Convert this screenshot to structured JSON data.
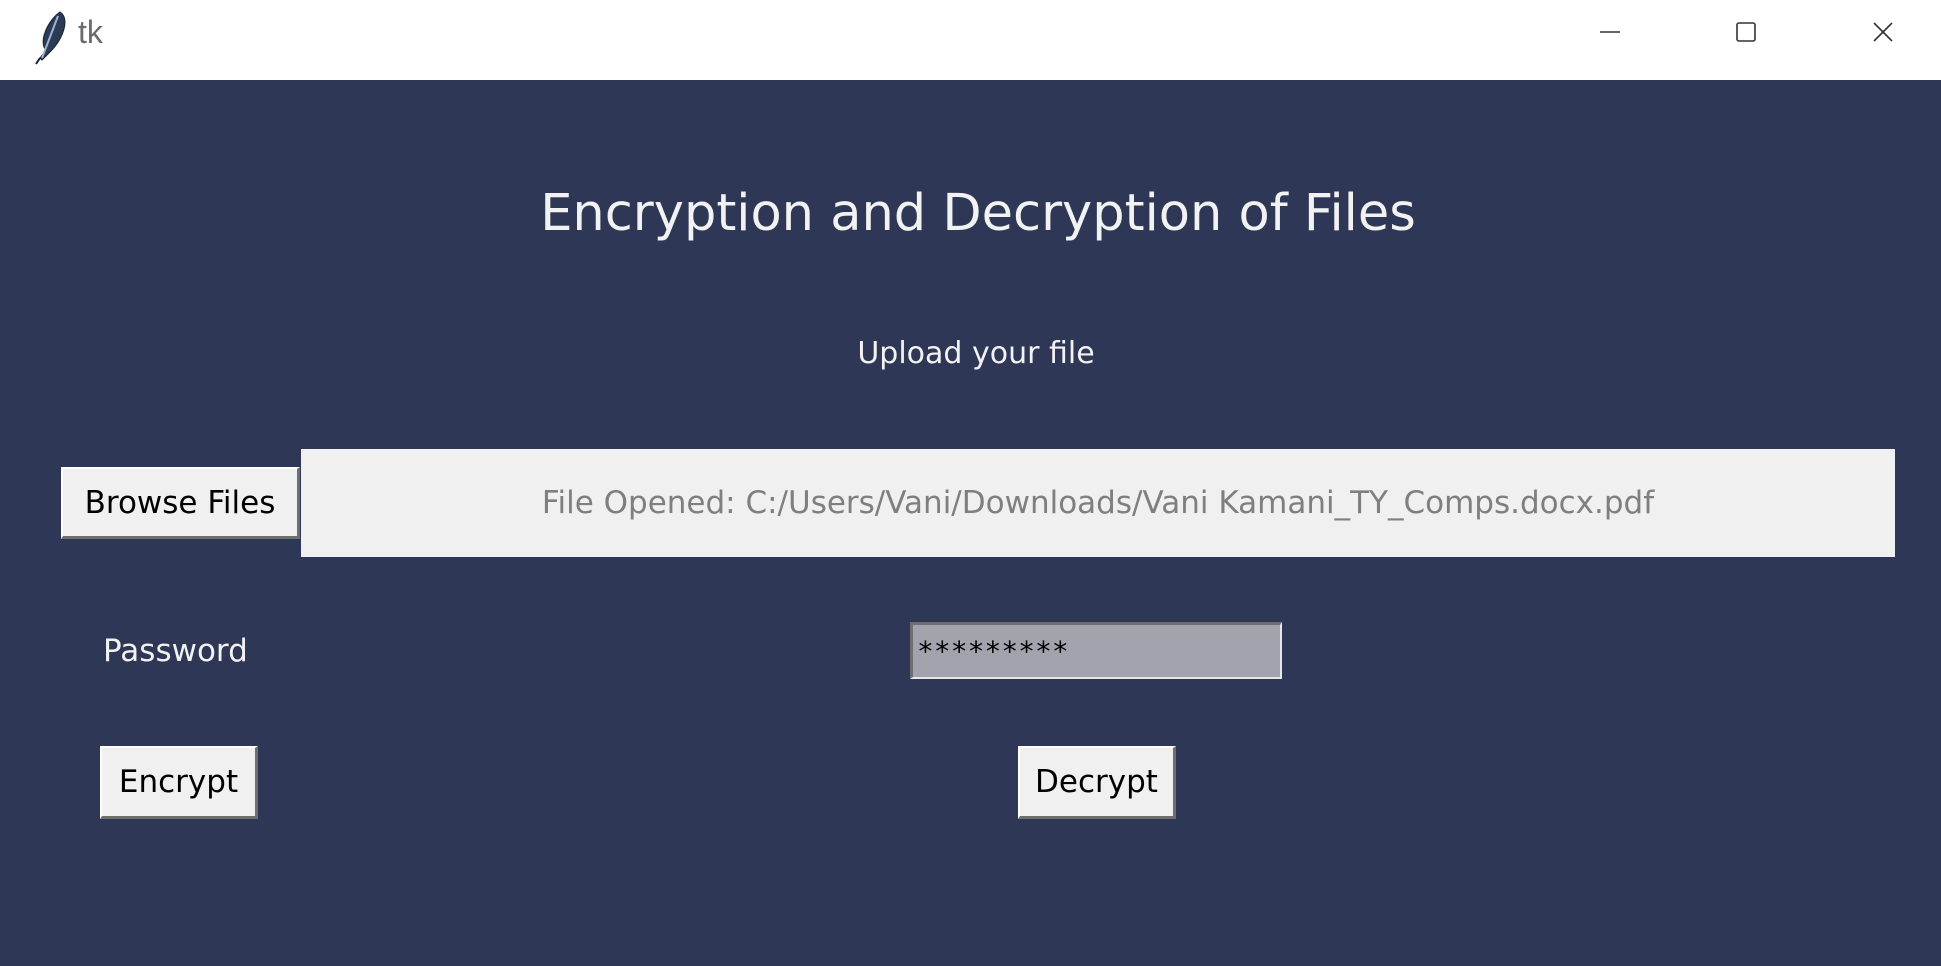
{
  "window": {
    "title": "tk"
  },
  "app": {
    "heading": "Encryption and Decryption of Files",
    "subheading": "Upload your file",
    "browse_label": "Browse Files",
    "file_status": "File Opened: C:/Users/Vani/Downloads/Vani Kamani_TY_Comps.docx.pdf",
    "password_label": "Password",
    "password_value": "*********",
    "encrypt_label": "Encrypt",
    "decrypt_label": "Decrypt"
  },
  "colors": {
    "background": "#2e3856",
    "text_light": "#f2f2f2",
    "button_face": "#f0f0f0",
    "entry_bg": "#a3a3ae"
  }
}
